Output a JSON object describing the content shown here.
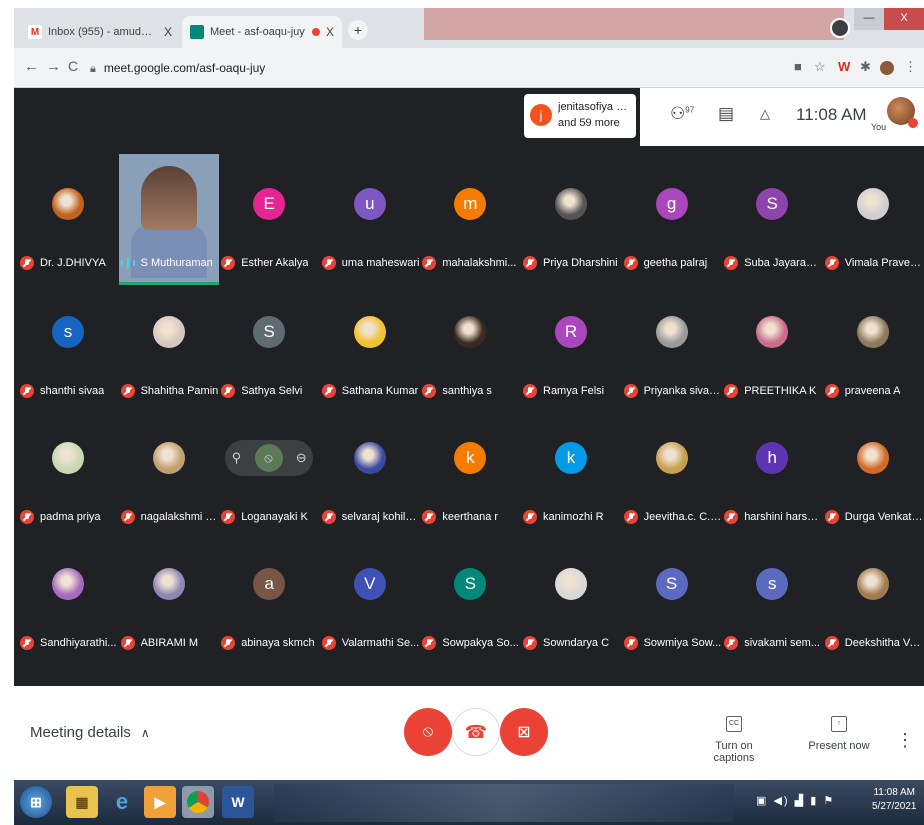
{
  "browser": {
    "tabs": [
      {
        "label": "Inbox (955) - amudha.palaniappa",
        "close": "X",
        "favicon": "M"
      },
      {
        "label": "Meet - asf-oaqu-juy",
        "close": "X",
        "favicon": "M"
      }
    ],
    "new_tab": "+",
    "window_controls": {
      "minimize": "—",
      "maximize": "▫",
      "close": "X"
    },
    "url": "meet.google.com/asf-oaqu-juy",
    "nav": {
      "back": "←",
      "forward": "→",
      "reload": "C"
    }
  },
  "meet_top": {
    "joined_name": "jenitasofiya sofi...",
    "joined_more": "and 59 more",
    "joined_initial": "j",
    "participants_count": "97",
    "clock": "11:08 AM",
    "you_label": "You"
  },
  "participants": [
    {
      "name": "Dr. J.DHIVYA",
      "initial": "",
      "color": "#c0611c",
      "photo": true
    },
    {
      "name": "S Muthuraman",
      "initial": "",
      "color": "",
      "photo": false,
      "video": true
    },
    {
      "name": "Esther Akalya",
      "initial": "E",
      "color": "#e52592"
    },
    {
      "name": "uma maheswari",
      "initial": "u",
      "color": "#7e57c2"
    },
    {
      "name": "mahalakshmi...",
      "initial": "m",
      "color": "#f57c00"
    },
    {
      "name": "Priya Dharshini",
      "initial": "",
      "color": "#555555",
      "photo": true
    },
    {
      "name": "geetha palraj",
      "initial": "g",
      "color": "#ab47bc"
    },
    {
      "name": "Suba Jayaram...",
      "initial": "S",
      "color": "#8e44ad"
    },
    {
      "name": "Vimala Pravee...",
      "initial": "",
      "color": "#cfcfcf",
      "photo": true
    },
    {
      "name": "shanthi sivaa",
      "initial": "s",
      "color": "#1565c0"
    },
    {
      "name": "Shahitha Pamin",
      "initial": "",
      "color": "#d8c7c0",
      "photo": true
    },
    {
      "name": "Sathya Selvi",
      "initial": "S",
      "color": "#5f6b73"
    },
    {
      "name": "Sathana Kumar",
      "initial": "",
      "color": "#f2c12e",
      "photo": true
    },
    {
      "name": "santhiya s",
      "initial": "",
      "color": "#3a2a22",
      "photo": true
    },
    {
      "name": "Ramya Felsi",
      "initial": "R",
      "color": "#ab47bc"
    },
    {
      "name": "Priyanka sivak...",
      "initial": "",
      "color": "#9a9a9a",
      "photo": true
    },
    {
      "name": "PREETHIKA K",
      "initial": "",
      "color": "#c86e8a",
      "photo": true
    },
    {
      "name": "praveena A",
      "initial": "",
      "color": "#8c7a5c",
      "photo": true
    },
    {
      "name": "padma priya",
      "initial": "",
      "color": "#c9d8b2",
      "photo": true
    },
    {
      "name": "nagalakshmi a...",
      "initial": "",
      "color": "#c2a070",
      "photo": true
    },
    {
      "name": "Loganayaki K",
      "initial": "",
      "color": "",
      "hover": true
    },
    {
      "name": "selvaraj kohila...",
      "initial": "",
      "color": "#3a4aa0",
      "photo": true
    },
    {
      "name": "keerthana r",
      "initial": "k",
      "color": "#f57c00"
    },
    {
      "name": "kanimozhi R",
      "initial": "k",
      "color": "#039be5"
    },
    {
      "name": "Jeevitha.c. C.j...",
      "initial": "",
      "color": "#c8a050",
      "photo": true
    },
    {
      "name": "harshini harshi...",
      "initial": "h",
      "color": "#5e35b1"
    },
    {
      "name": "Durga Venkata...",
      "initial": "",
      "color": "#d26a2a",
      "photo": true
    },
    {
      "name": "Sandhiyarathi...",
      "initial": "",
      "color": "#a56bbf",
      "photo": true
    },
    {
      "name": "ABIRAMI M",
      "initial": "",
      "color": "#8f86b6",
      "photo": true
    },
    {
      "name": "abinaya skmch",
      "initial": "a",
      "color": "#795548"
    },
    {
      "name": "Valarmathi Se...",
      "initial": "V",
      "color": "#3f51b5"
    },
    {
      "name": "Sowpakya So...",
      "initial": "S",
      "color": "#00897b"
    },
    {
      "name": "Sowndarya C",
      "initial": "",
      "color": "#d8d8d8",
      "photo": true
    },
    {
      "name": "Sowmiya Sow...",
      "initial": "S",
      "color": "#5c6bc0"
    },
    {
      "name": "sivakami sem...",
      "initial": "s",
      "color": "#5c6bc0"
    },
    {
      "name": "Deekshitha Va...",
      "initial": "",
      "color": "#a27a52",
      "photo": true
    }
  ],
  "bottom": {
    "meeting_details": "Meeting details",
    "captions_label": "Turn on captions",
    "captions_icon": "CC",
    "present_label": "Present now",
    "more": "⋮"
  },
  "taskbar": {
    "time": "11:08 AM",
    "date": "5/27/2021"
  }
}
